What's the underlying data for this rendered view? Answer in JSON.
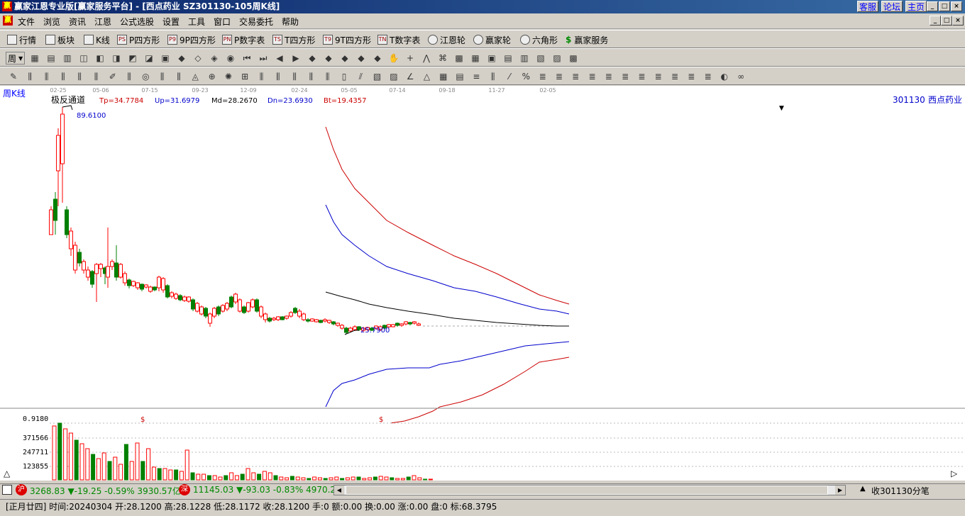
{
  "titlebar": {
    "title": "赢家江恩专业版[赢家服务平台] - [西点药业   SZ301130-105周K线]",
    "links": [
      "客服",
      "论坛",
      "主页"
    ],
    "appicon": "赢"
  },
  "menubar": {
    "items": [
      "文件",
      "浏览",
      "资讯",
      "江恩",
      "公式选股",
      "设置",
      "工具",
      "窗口",
      "交易委托",
      "帮助"
    ]
  },
  "toolbar1": {
    "items": [
      {
        "label": "行情",
        "icon": "grid-icon"
      },
      {
        "label": "板块",
        "icon": "blocks-icon"
      },
      {
        "label": "K线",
        "icon": "kline-icon"
      },
      {
        "label": "P四方形",
        "icon": "PS"
      },
      {
        "label": "9P四方形",
        "icon": "P9"
      },
      {
        "label": "P数字表",
        "icon": "PN"
      },
      {
        "label": "T四方形",
        "icon": "TS"
      },
      {
        "label": "9T四方形",
        "icon": "T9"
      },
      {
        "label": "T数字表",
        "icon": "TN"
      },
      {
        "label": "江恩轮",
        "icon": "wheel-icon"
      },
      {
        "label": "赢家轮",
        "icon": "wheel-icon"
      },
      {
        "label": "六角形",
        "icon": "hexagon-icon"
      },
      {
        "label": "赢家服务",
        "icon": "dollar-icon"
      }
    ]
  },
  "toolbar2": {
    "period": "周"
  },
  "chart": {
    "label": "周K线",
    "indicator": "极反通道",
    "tp": "Tp=34.7784",
    "up": "Up=31.6979",
    "md": "Md=28.2670",
    "dn": "Dn=23.6930",
    "bt": "Bt=19.4357",
    "stock_code": "301130",
    "stock_name": "西点药业",
    "high_label": "89.6100",
    "low_label": "25.7900",
    "dates": [
      "02-25",
      "05-06",
      "07-15",
      "09-23",
      "12-09",
      "02-24",
      "05-05",
      "07-14",
      "09-18",
      "11-27",
      "02-05"
    ],
    "vol_labels": [
      "0.9180",
      "371566",
      "247711",
      "123855"
    ],
    "dollar_mark": "$"
  },
  "chart_data": {
    "type": "candlestick",
    "title": "周K线",
    "y_high": 89.61,
    "y_low": 25.79,
    "indicator_values": {
      "Tp": 34.7784,
      "Up": 31.6979,
      "Md": 28.267,
      "Dn": 23.693,
      "Bt": 19.4357
    },
    "colors": {
      "up": "#ff0000",
      "down": "#008000"
    }
  },
  "bottombar": {
    "sh_badge": "沪",
    "sh": "3268.83 ▼-19.25 -0.59% 3930.57亿",
    "sz_badge": "深",
    "sz": "11145.03 ▼-93.03 -0.83% 4970.2",
    "right": "收301130分笔"
  },
  "statusbar": {
    "text": "[正月廿四] 时间:20240304 开:28.1200 高:28.1228 低:28.1172 收:28.1200 手:0 额:0.00 换:0.00 涨:0.00 盘:0 标:68.3795"
  }
}
